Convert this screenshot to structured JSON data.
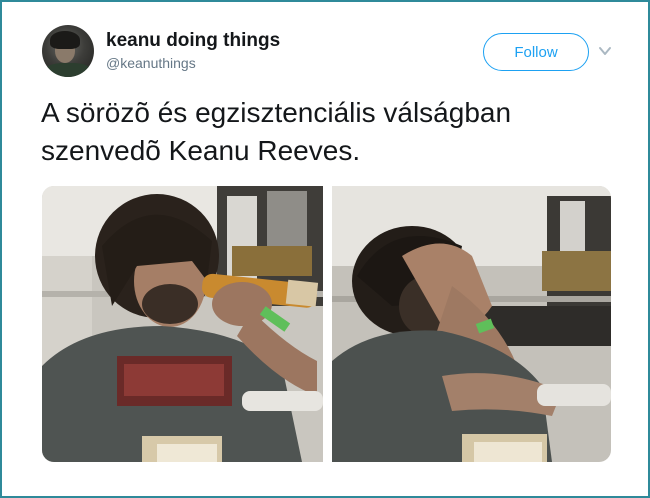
{
  "tweet": {
    "author": {
      "display_name": "keanu doing things",
      "handle": "@keanuthings"
    },
    "follow_label": "Follow",
    "text": "A sörözõ és egzisztenciális válságban szenvedõ Keanu Reeves.",
    "media": [
      {
        "icon": "photo-drinking-beer"
      },
      {
        "icon": "photo-head-in-hands"
      }
    ]
  },
  "colors": {
    "frame_border": "#2f8a9a",
    "accent": "#1da1f2",
    "text_primary": "#14171a",
    "text_secondary": "#657786"
  }
}
